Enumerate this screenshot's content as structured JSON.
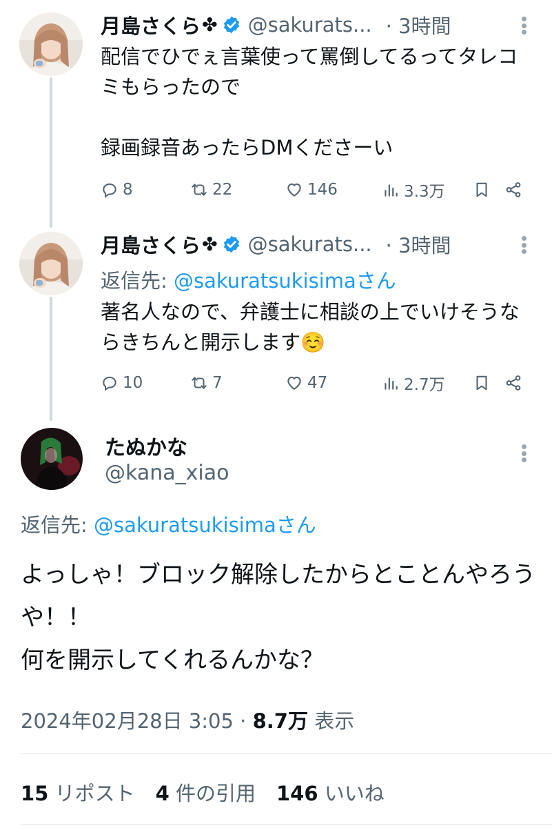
{
  "tweets": [
    {
      "display_name": "月島さくら",
      "name_emoji": "✤",
      "handle": "@sakurats...",
      "time": "· 3時間",
      "text": "配信でひでぇ言葉使って罵倒してるってタレコミもらったので\n\n録画録音あったらDMくださーい",
      "replies": "8",
      "reposts": "22",
      "likes": "146",
      "views": "3.3万"
    },
    {
      "display_name": "月島さくら",
      "name_emoji": "✤",
      "handle": "@sakurats...",
      "time": "· 3時間",
      "reply_prefix": "返信先: ",
      "reply_to": "@sakuratsukisimaさん",
      "text": "著名人なので、弁護士に相談の上でいけそうならきちんと開示します☺️",
      "replies": "10",
      "reposts": "7",
      "likes": "47",
      "views": "2.7万"
    }
  ],
  "main": {
    "display_name": "たぬかな",
    "handle": "@kana_xiao",
    "reply_prefix": "返信先: ",
    "reply_to": "@sakuratsukisimaさん",
    "text": "よっしゃ！ブロック解除したからとことんやろうや！！\n何を開示してくれるんかな？",
    "timestamp": "2024年02月28日 3:05 · ",
    "views": "8.7万",
    "views_label": " 表示",
    "reposts_count": "15",
    "reposts_label": " リポスト",
    "quotes_count": "4",
    "quotes_label": " 件の引用",
    "likes_count": "146",
    "likes_label": " いいね"
  },
  "icons": [
    "reply-icon",
    "repost-icon",
    "like-icon",
    "views-icon",
    "bookmark-icon",
    "share-icon",
    "verified-icon",
    "more-icon"
  ],
  "colors": {
    "link": "#1d9bf0",
    "secondary": "#536471",
    "primary": "#0f1419",
    "thread_line": "#cfd9de"
  }
}
